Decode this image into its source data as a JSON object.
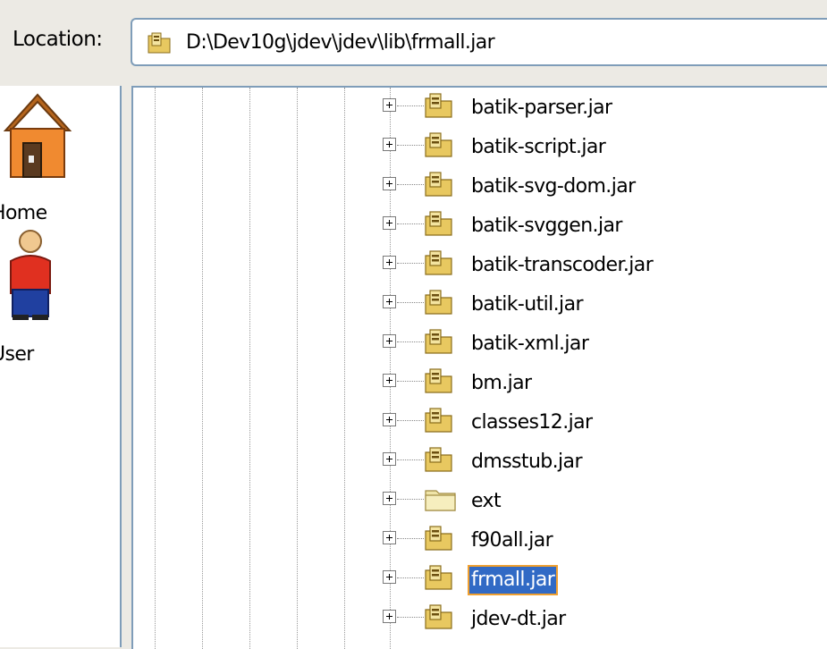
{
  "location": {
    "label": "Location:",
    "path": "D:\\Dev10g\\jdev\\jdev\\lib\\frmall.jar"
  },
  "places": [
    {
      "label": "Home",
      "icon": "home-icon"
    },
    {
      "label": "User",
      "icon": "user-icon"
    }
  ],
  "tree": {
    "items": [
      {
        "name": "batik-parser.jar",
        "type": "jar"
      },
      {
        "name": "batik-script.jar",
        "type": "jar"
      },
      {
        "name": "batik-svg-dom.jar",
        "type": "jar"
      },
      {
        "name": "batik-svggen.jar",
        "type": "jar"
      },
      {
        "name": "batik-transcoder.jar",
        "type": "jar"
      },
      {
        "name": "batik-util.jar",
        "type": "jar"
      },
      {
        "name": "batik-xml.jar",
        "type": "jar"
      },
      {
        "name": "bm.jar",
        "type": "jar"
      },
      {
        "name": "classes12.jar",
        "type": "jar"
      },
      {
        "name": "dmsstub.jar",
        "type": "jar"
      },
      {
        "name": "ext",
        "type": "folder"
      },
      {
        "name": "f90all.jar",
        "type": "jar"
      },
      {
        "name": "frmall.jar",
        "type": "jar",
        "selected": true
      },
      {
        "name": "jdev-dt.jar",
        "type": "jar"
      }
    ]
  },
  "colors": {
    "selection": "#316ac5",
    "focus_outline": "#f0a030",
    "border": "#7f9db9"
  }
}
